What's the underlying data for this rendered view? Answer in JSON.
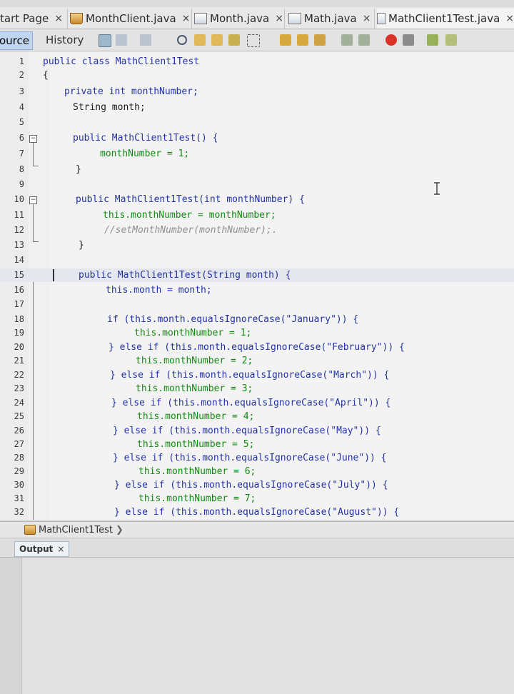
{
  "tabs": [
    {
      "label": "tart Page",
      "close": "×",
      "icon": "none"
    },
    {
      "label": "MonthClient.java",
      "close": "×",
      "icon": "java-cup-icon"
    },
    {
      "label": "Month.java",
      "close": "×",
      "icon": "java-file-icon"
    },
    {
      "label": "Math.java",
      "close": "×",
      "icon": "java-file-icon"
    },
    {
      "label": "MathClient1Test.java",
      "close": "×",
      "icon": "java-file-icon"
    }
  ],
  "toolbar": {
    "source_label": "ource",
    "history_label": "History"
  },
  "editor": {
    "lines": [
      {
        "n": "1",
        "text": "public class MathClient1Test"
      },
      {
        "n": "2",
        "text": "{"
      },
      {
        "n": "3",
        "text": "private int monthNumber;"
      },
      {
        "n": "4",
        "text": "String month;"
      },
      {
        "n": "5",
        "text": ""
      },
      {
        "n": "6",
        "text": "public MathClient1Test() {"
      },
      {
        "n": "7",
        "text": "monthNumber = 1;"
      },
      {
        "n": "8",
        "text": "}"
      },
      {
        "n": "9",
        "text": ""
      },
      {
        "n": "10",
        "text": "public MathClient1Test(int monthNumber) {"
      },
      {
        "n": "11",
        "text": "this.monthNumber = monthNumber;"
      },
      {
        "n": "12",
        "text": "//setMonthNumber(monthNumber);."
      },
      {
        "n": "13",
        "text": "}"
      },
      {
        "n": "14",
        "text": ""
      },
      {
        "n": "15",
        "text": "public MathClient1Test(String month) {"
      },
      {
        "n": "16",
        "text": "this.month = month;"
      },
      {
        "n": "17",
        "text": ""
      },
      {
        "n": "18",
        "text": "if (this.month.equalsIgnoreCase(\"January\")) {"
      },
      {
        "n": "19",
        "text": "this.monthNumber = 1;"
      },
      {
        "n": "20",
        "text": "} else if (this.month.equalsIgnoreCase(\"February\")) {"
      },
      {
        "n": "21",
        "text": "this.monthNumber = 2;"
      },
      {
        "n": "22",
        "text": "} else if (this.month.equalsIgnoreCase(\"March\")) {"
      },
      {
        "n": "23",
        "text": "this.monthNumber = 3;"
      },
      {
        "n": "24",
        "text": "} else if (this.month.equalsIgnoreCase(\"April\")) {"
      },
      {
        "n": "25",
        "text": "this.monthNumber = 4;"
      },
      {
        "n": "26",
        "text": "} else if (this.month.equalsIgnoreCase(\"May\")) {"
      },
      {
        "n": "27",
        "text": "this.monthNumber = 5;"
      },
      {
        "n": "28",
        "text": "} else if (this.month.equalsIgnoreCase(\"June\")) {"
      },
      {
        "n": "29",
        "text": "this.monthNumber = 6;"
      },
      {
        "n": "30",
        "text": "} else if (this.month.equalsIgnoreCase(\"July\")) {"
      },
      {
        "n": "31",
        "text": "this.monthNumber = 7;"
      },
      {
        "n": "32",
        "text": "} else if (this.month.equalsIgnoreCase(\"August\")) {"
      }
    ]
  },
  "breadcrumb": {
    "label": "MathClient1Test",
    "arrow": "❯"
  },
  "output": {
    "tab_label": "Output",
    "close": "×"
  },
  "colors": {
    "keyword": "#2233a8",
    "field": "#128a12",
    "string": "#b8491e",
    "comment": "#8f8f8f"
  }
}
